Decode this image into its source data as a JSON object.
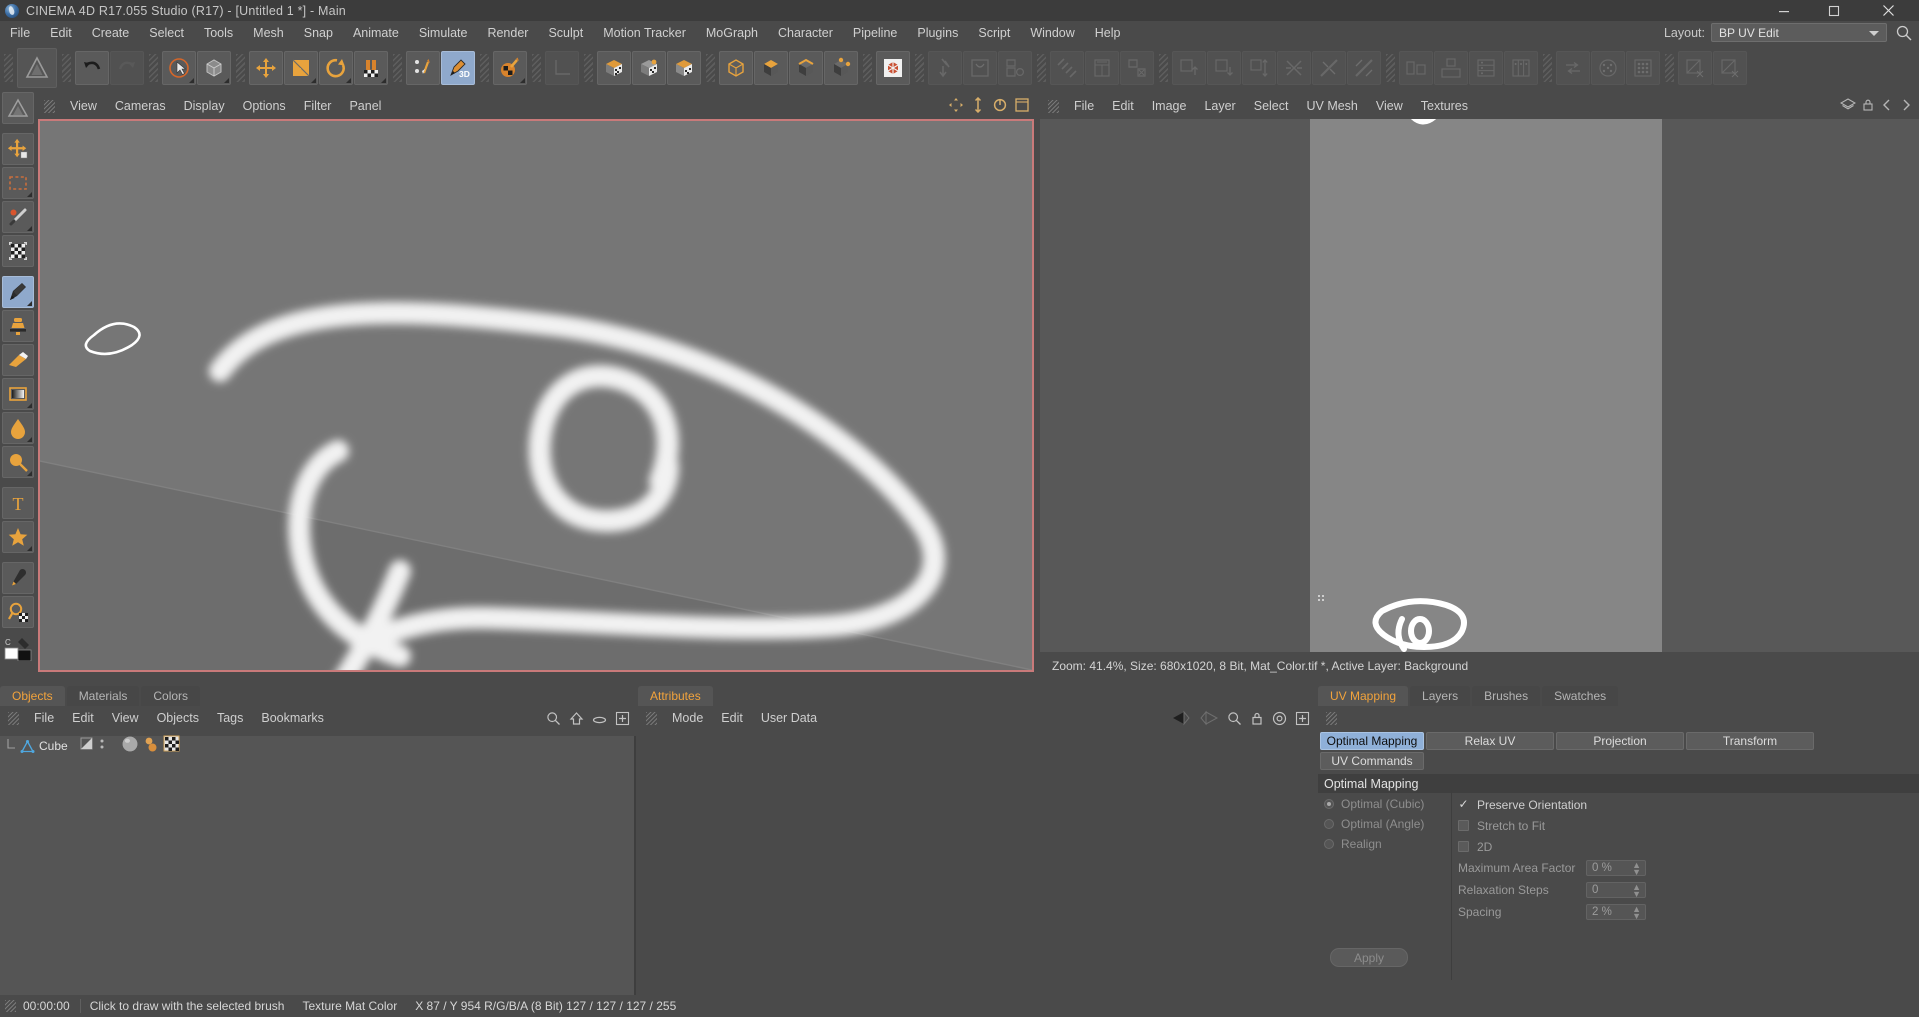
{
  "titlebar": {
    "title": "CINEMA 4D R17.055 Studio (R17) - [Untitled 1 *] - Main",
    "app_icon": "cinema4d-logo-icon",
    "minimize": "minimize-icon",
    "maximize": "maximize-icon",
    "close": "close-icon"
  },
  "menubar": {
    "items": [
      {
        "label": "File"
      },
      {
        "label": "Edit"
      },
      {
        "label": "Create"
      },
      {
        "label": "Select"
      },
      {
        "label": "Tools"
      },
      {
        "label": "Mesh"
      },
      {
        "label": "Snap"
      },
      {
        "label": "Animate"
      },
      {
        "label": "Simulate"
      },
      {
        "label": "Render"
      },
      {
        "label": "Sculpt"
      },
      {
        "label": "Motion Tracker"
      },
      {
        "label": "MoGraph"
      },
      {
        "label": "Character"
      },
      {
        "label": "Pipeline"
      },
      {
        "label": "Plugins"
      },
      {
        "label": "Script"
      },
      {
        "label": "Window"
      },
      {
        "label": "Help"
      }
    ],
    "layout_label": "Layout:",
    "layout_value": "BP UV Edit",
    "search_icon": "search-icon"
  },
  "toolbar": {
    "buttons": [
      {
        "name": "undo-button",
        "icon": "undo-arrow-icon"
      },
      {
        "name": "redo-button",
        "icon": "redo-arrow-icon"
      },
      {
        "name": "live-selection-button",
        "icon": "cursor-circle-icon"
      },
      {
        "name": "model-mode-button",
        "icon": "cube-wire-icon"
      },
      {
        "name": "move-button",
        "icon": "move-cross-icon"
      },
      {
        "name": "scale-button",
        "icon": "scale-square-icon"
      },
      {
        "name": "rotate-button",
        "icon": "rotate-ring-icon"
      },
      {
        "name": "magnet-button",
        "icon": "magnet-icon"
      },
      {
        "name": "workplane-button",
        "icon": "points-brush-icon"
      },
      {
        "name": "paint-3d-button",
        "icon": "brush-3d-icon"
      },
      {
        "name": "texture-paint-button",
        "icon": "paint-ball-icon"
      },
      {
        "name": "axis-button",
        "icon": "axis-corner-icon"
      },
      {
        "name": "texture-mode-button",
        "icon": "checker-cube-icon"
      },
      {
        "name": "texture-axis-button",
        "icon": "checker-cube-dot-icon"
      },
      {
        "name": "uv-polygon-button",
        "icon": "checker-cube-open-icon"
      },
      {
        "name": "object-mode-button",
        "icon": "cube-outline-icon"
      },
      {
        "name": "polygon-mode-button",
        "icon": "cube-solid-icon"
      },
      {
        "name": "edge-mode-button",
        "icon": "cube-edge-icon"
      },
      {
        "name": "point-mode-button",
        "icon": "cube-point-icon"
      },
      {
        "name": "uv-mesh-button",
        "icon": "hex-pattern-icon"
      },
      {
        "name": "uv-tool-1-button",
        "icon": "uv-arrow-icon"
      },
      {
        "name": "uv-tool-2-button",
        "icon": "uv-frame-icon"
      },
      {
        "name": "uv-tool-3-button",
        "icon": "uv-panel-icon"
      },
      {
        "name": "uv-tool-4-button",
        "icon": "uv-hatch-icon"
      },
      {
        "name": "uv-tool-5-button",
        "icon": "uv-grid-icon"
      },
      {
        "name": "uv-tool-6-button",
        "icon": "uv-swap-icon"
      },
      {
        "name": "uv-align-up-button",
        "icon": "align-up-icon"
      },
      {
        "name": "uv-align-down-button",
        "icon": "align-down-icon"
      },
      {
        "name": "uv-align-vert-button",
        "icon": "align-vertical-icon"
      },
      {
        "name": "uv-flip-1-button",
        "icon": "flip-diagonal-icon"
      },
      {
        "name": "uv-flip-2-button",
        "icon": "flip-diagonal-2-icon"
      },
      {
        "name": "uv-flip-3-button",
        "icon": "flip-diagonal-3-icon"
      },
      {
        "name": "uv-arrange-1-button",
        "icon": "arrange-side-icon"
      },
      {
        "name": "uv-arrange-2-button",
        "icon": "arrange-top-icon"
      },
      {
        "name": "uv-arrange-3-button",
        "icon": "arrange-rows-icon"
      },
      {
        "name": "uv-arrange-4-button",
        "icon": "arrange-cols-icon"
      },
      {
        "name": "uv-transfer-button",
        "icon": "transfer-icon"
      },
      {
        "name": "uv-sphere-button",
        "icon": "sphere-points-icon"
      },
      {
        "name": "uv-grid-points-button",
        "icon": "grid-points-icon"
      },
      {
        "name": "uv-proj-1-button",
        "icon": "projection-1-icon"
      },
      {
        "name": "uv-proj-2-button",
        "icon": "projection-2-icon"
      }
    ]
  },
  "left_palette": {
    "tools": [
      {
        "name": "logo-button",
        "icon": "c4d-mark-icon"
      },
      {
        "name": "move-tool",
        "icon": "move-cross-icon"
      },
      {
        "name": "rect-select-tool",
        "icon": "rect-marquee-icon"
      },
      {
        "name": "magic-wand-tool",
        "icon": "magic-wand-icon"
      },
      {
        "name": "transform-tool",
        "icon": "transform-checker-icon"
      },
      {
        "name": "brush-tool",
        "icon": "paint-brush-icon"
      },
      {
        "name": "clone-tool",
        "icon": "clone-stamp-icon"
      },
      {
        "name": "eraser-tool",
        "icon": "eraser-icon"
      },
      {
        "name": "gradient-tool",
        "icon": "gradient-icon"
      },
      {
        "name": "fill-tool",
        "icon": "paint-drop-icon"
      },
      {
        "name": "blur-tool",
        "icon": "blur-icon"
      },
      {
        "name": "text-tool",
        "icon": "text-t-icon"
      },
      {
        "name": "shape-tool",
        "icon": "star-shape-icon"
      },
      {
        "name": "eyedropper-tool",
        "icon": "eyedropper-icon"
      },
      {
        "name": "zoom-tool",
        "icon": "magnifier-checker-icon"
      },
      {
        "name": "color-swatch",
        "icon": "foreground-background-swatch-icon"
      }
    ]
  },
  "viewport": {
    "menus": [
      "View",
      "Cameras",
      "Display",
      "Options",
      "Filter",
      "Panel"
    ],
    "header_icons": [
      "move-view-icon",
      "scale-view-icon",
      "rotate-view-icon",
      "maximize-view-icon"
    ],
    "background_color": "#767676",
    "border_color": "#c97a7a",
    "stroke_color": "#f0f0f0"
  },
  "uv_panel": {
    "menus": [
      "File",
      "Edit",
      "Image",
      "Layer",
      "Select",
      "UV Mesh",
      "View",
      "Textures"
    ],
    "header_icons": [
      "layer-icon",
      "lock-icon",
      "arrow-left-icon",
      "arrow-right-icon"
    ],
    "status": "Zoom: 41.4%, Size: 680x1020, 8 Bit, Mat_Color.tif *, Active Layer: Background",
    "canvas_color": "#868686"
  },
  "objects_panel": {
    "tabs": [
      {
        "label": "Objects",
        "active": true
      },
      {
        "label": "Materials",
        "active": false
      },
      {
        "label": "Colors",
        "active": false
      }
    ],
    "menus": [
      "File",
      "Edit",
      "View",
      "Objects",
      "Tags",
      "Bookmarks"
    ],
    "header_icons": [
      "search-icon",
      "home-icon",
      "ellipse-icon",
      "plus-box-icon"
    ],
    "rows": [
      {
        "name": "Cube",
        "icon": "polygon-object-icon",
        "tags": [
          "material-tag-icon",
          "paint-tag-icon",
          "uvw-tag-icon"
        ]
      }
    ]
  },
  "attributes_panel": {
    "tabs": [
      {
        "label": "Attributes",
        "active": true
      }
    ],
    "menus": [
      "Mode",
      "Edit",
      "User Data"
    ],
    "header_icons": [
      "back-arrow-icon",
      "forward-arrow-icon",
      "search-icon",
      "lock-icon",
      "target-icon",
      "plus-box-icon"
    ]
  },
  "uv_mapping_panel": {
    "tabs": [
      {
        "label": "UV Mapping",
        "active": true
      },
      {
        "label": "Layers",
        "active": false
      },
      {
        "label": "Brushes",
        "active": false
      },
      {
        "label": "Swatches",
        "active": false
      }
    ],
    "mode_buttons": [
      {
        "label": "Optimal Mapping",
        "selected": true
      },
      {
        "label": "Relax UV",
        "selected": false
      },
      {
        "label": "Projection",
        "selected": false
      },
      {
        "label": "Transform",
        "selected": false
      }
    ],
    "sub_buttons": [
      {
        "label": "UV Commands",
        "selected": false
      }
    ],
    "section_title": "Optimal Mapping",
    "radios": [
      {
        "label": "Optimal (Cubic)",
        "checked": true
      },
      {
        "label": "Optimal (Angle)",
        "checked": false
      },
      {
        "label": "Realign",
        "checked": false
      }
    ],
    "checkboxes": [
      {
        "label": "Preserve Orientation",
        "checked": true
      },
      {
        "label": "Stretch to Fit",
        "checked": false
      },
      {
        "label": "2D",
        "checked": false
      }
    ],
    "numeric_fields": [
      {
        "label": "Maximum Area Factor",
        "value": "0 %"
      },
      {
        "label": "Relaxation Steps",
        "value": "0"
      },
      {
        "label": "Spacing",
        "value": "2 %"
      }
    ],
    "apply_label": "Apply"
  },
  "statusbar": {
    "grip_icon": "grip-icon",
    "time": "00:00:00",
    "hint": "Click to draw with the selected brush",
    "texture": "Texture Mat Color",
    "coords": "X 87 / Y 954 R/G/B/A (8 Bit) 127 / 127 / 127 / 255"
  },
  "colors": {
    "window_bg": "#4a4a4a",
    "panel_bg": "#555555",
    "accent_orange": "#f2a33c",
    "accent_blue": "#8fb0d8",
    "viewport_bg": "#767676",
    "viewport_border": "#c97a7a",
    "icon_orange": "#e8a33d"
  }
}
